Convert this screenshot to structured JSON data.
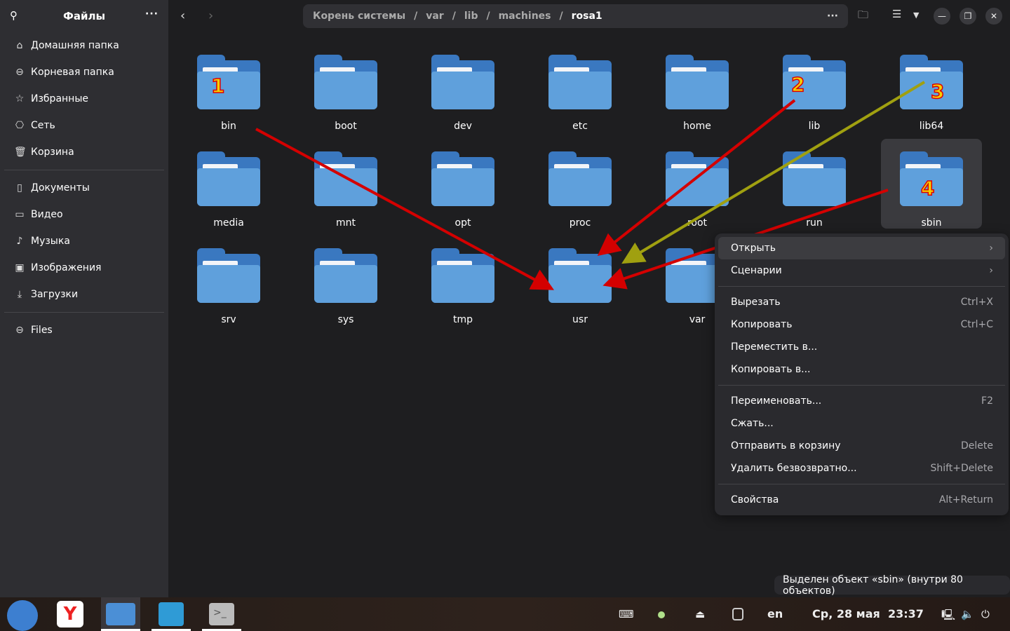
{
  "sidebar": {
    "title": "Файлы",
    "items": [
      {
        "label": "Домашняя папка",
        "icon": "home-icon"
      },
      {
        "label": "Корневая папка",
        "icon": "drive-icon"
      },
      {
        "label": "Избранные",
        "icon": "star-icon"
      },
      {
        "label": "Сеть",
        "icon": "network-icon"
      },
      {
        "label": "Корзина",
        "icon": "trash-icon"
      },
      {
        "label": "Документы",
        "icon": "document-icon"
      },
      {
        "label": "Видео",
        "icon": "video-icon"
      },
      {
        "label": "Музыка",
        "icon": "music-icon"
      },
      {
        "label": "Изображения",
        "icon": "image-icon"
      },
      {
        "label": "Загрузки",
        "icon": "download-icon"
      },
      {
        "label": "Files",
        "icon": "drive-icon"
      }
    ]
  },
  "path": {
    "segments": [
      "Корень системы",
      "var",
      "lib",
      "machines",
      "rosa1"
    ],
    "sep": "/"
  },
  "folders": [
    "bin",
    "boot",
    "dev",
    "etc",
    "home",
    "lib",
    "lib64",
    "media",
    "mnt",
    "opt",
    "proc",
    "root",
    "run",
    "sbin",
    "srv",
    "sys",
    "tmp",
    "usr",
    "var"
  ],
  "selected": "sbin",
  "annotations": {
    "1": "1",
    "2": "2",
    "3": "3",
    "4": "4"
  },
  "menu": [
    {
      "label": "Открыть",
      "shortcut": "›"
    },
    {
      "label": "Сценарии",
      "shortcut": "›"
    },
    {
      "label": "Вырезать",
      "shortcut": "Ctrl+X"
    },
    {
      "label": "Копировать",
      "shortcut": "Ctrl+C"
    },
    {
      "label": "Переместить в...",
      "shortcut": ""
    },
    {
      "label": "Копировать в...",
      "shortcut": ""
    },
    {
      "label": "Переименовать...",
      "shortcut": "F2"
    },
    {
      "label": "Сжать...",
      "shortcut": ""
    },
    {
      "label": "Отправить в корзину",
      "shortcut": "Delete"
    },
    {
      "label": "Удалить безвозвратно...",
      "shortcut": "Shift+Delete"
    },
    {
      "label": "Свойства",
      "shortcut": "Alt+Return"
    }
  ],
  "status": "Выделен объект «sbin» (внутри 80 объектов)",
  "taskbar": {
    "lang": "en",
    "datetime": "Ср, 28 мая  23:37"
  },
  "colors": {
    "folder": "#5fa0dc",
    "arrow_red": "#d40000",
    "arrow_olive": "#a0a010"
  }
}
